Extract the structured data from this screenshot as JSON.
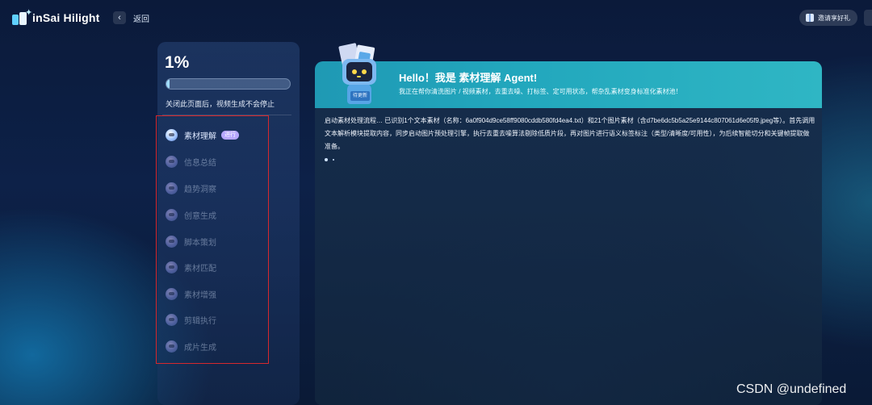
{
  "topbar": {
    "logo_text": "inSai Hilight",
    "back_label": "返回",
    "invite_label": "邀请享好礼"
  },
  "progress": {
    "percent_text": "1%",
    "value": 0.01,
    "note": "关闭此页面后，视频生成不会停止"
  },
  "steps": [
    {
      "label": "素材理解",
      "icon": "robot-icon",
      "active": true,
      "badge": "进行"
    },
    {
      "label": "信息总结",
      "icon": "robot-icon",
      "active": false
    },
    {
      "label": "趋势洞察",
      "icon": "robot-icon",
      "active": false
    },
    {
      "label": "创意生成",
      "icon": "robot-icon",
      "active": false
    },
    {
      "label": "脚本策划",
      "icon": "robot-icon",
      "active": false
    },
    {
      "label": "素材匹配",
      "icon": "robot-icon",
      "active": false
    },
    {
      "label": "素材增强",
      "icon": "robot-icon",
      "active": false
    },
    {
      "label": "剪辑执行",
      "icon": "robot-icon",
      "active": false
    },
    {
      "label": "成片生成",
      "icon": "robot-icon",
      "active": false
    }
  ],
  "agent": {
    "title": "Hello！我是 素材理解 Agent!",
    "subtitle": "我正在帮你清洗图片 / 视频素材，去重去噪、打标签、定可用状态，帮杂乱素材变身标准化素材池！",
    "robot_sign": "待更新",
    "message": "启动素材处理流程… 已识别1个文本素材（名称：6a0f904d9ce58ff9080cddb580fd4ea4.txt）和21个图片素材（含d7be6dc5b5a25e9144c807061d6e05f9.jpeg等）。首先调用文本解析模块提取内容，同步启动图片预处理引擎，执行去重去噪算法剔除低质片段，再对图片进行语义标签标注（类型/清晰度/可用性），为后续智能切分和关键帧提取做准备。"
  },
  "watermark": "CSDN @undefined",
  "colors": {
    "accent": "#22a7bd",
    "highlight_box": "#d6282d",
    "badge": "#b7a7ff"
  }
}
